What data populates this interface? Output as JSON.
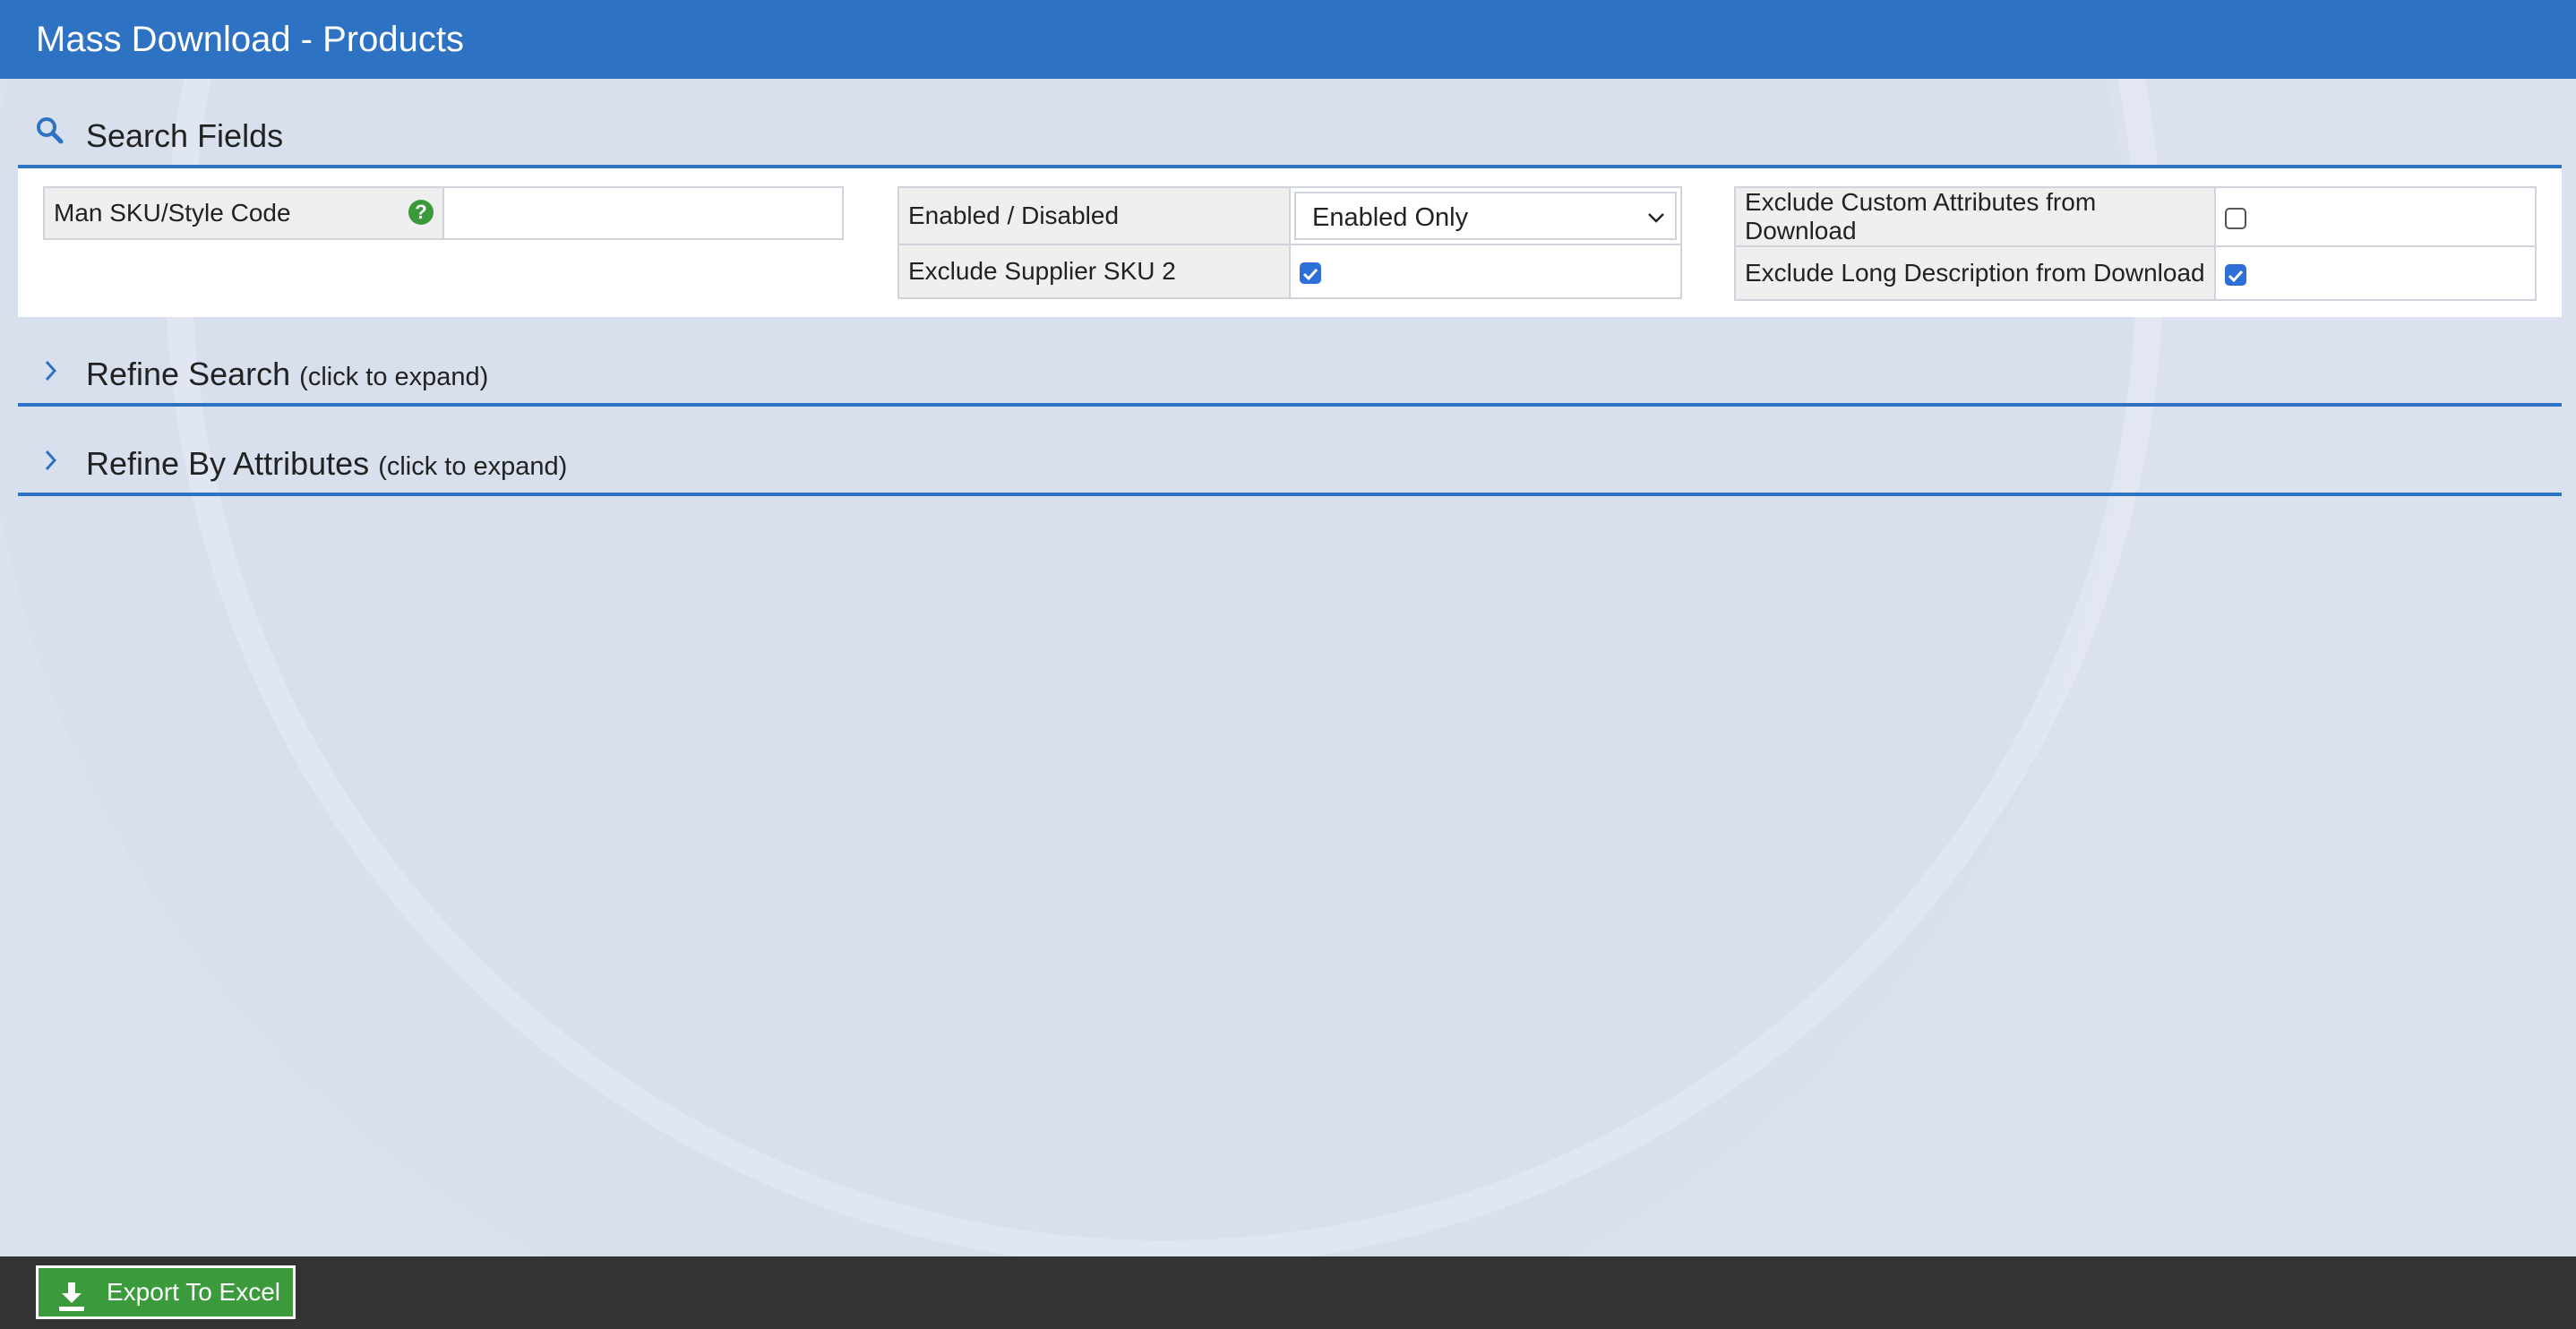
{
  "header": {
    "title": "Mass Download - Products"
  },
  "search_fields": {
    "title": "Search Fields",
    "icon": "search-icon",
    "man_sku_label": "Man SKU/Style Code",
    "man_sku_value": "",
    "enabled_label": "Enabled / Disabled",
    "enabled_value": "Enabled Only",
    "exclude_supplier_sku2_label": "Exclude Supplier SKU 2",
    "exclude_supplier_sku2_checked": true,
    "exclude_custom_attrs_label": "Exclude Custom Attributes from Download",
    "exclude_custom_attrs_checked": false,
    "exclude_long_desc_label": "Exclude Long Description from Download",
    "exclude_long_desc_checked": true
  },
  "refine_search": {
    "title": "Refine Search",
    "hint": "(click to expand)"
  },
  "refine_attributes": {
    "title": "Refine By Attributes",
    "hint": "(click to expand)"
  },
  "footer": {
    "export_label": "Export To Excel"
  },
  "colors": {
    "header_bg": "#2e72c3",
    "accent": "#2e72c3",
    "export_button": "#3b9a3b",
    "footer_bg": "#333333",
    "help_icon": "#3a9a3a"
  }
}
